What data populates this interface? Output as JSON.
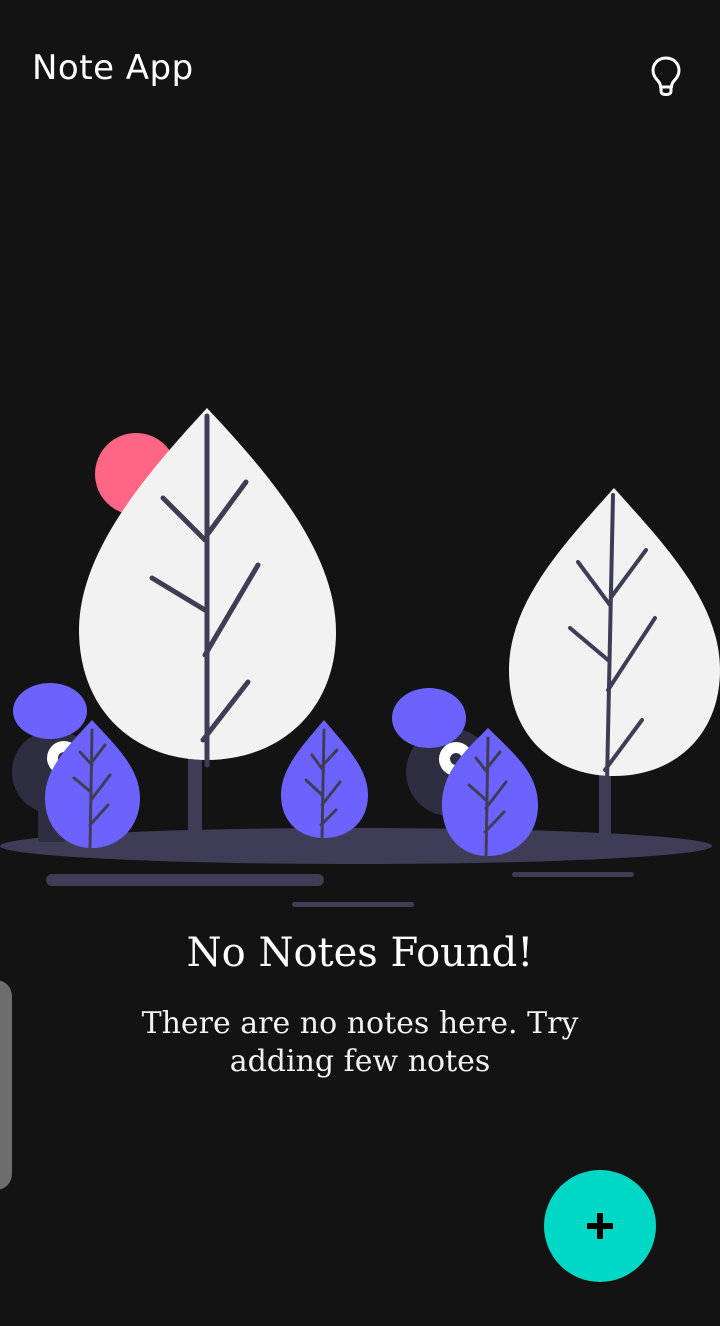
{
  "header": {
    "title": "Note App",
    "theme_toggle_icon": "lightbulb-icon"
  },
  "empty_state": {
    "title": "No Notes Found!",
    "message": "There are no notes here. Try adding few notes",
    "illustration": "trees-and-creatures-illustration"
  },
  "fab": {
    "icon": "plus-icon"
  },
  "colors": {
    "background": "#131313",
    "accent": "#00d7c4",
    "illustration_purple": "#6c63ff",
    "illustration_pink": "#ff6584",
    "illustration_dark": "#3f3d56",
    "illustration_light": "#f2f2f2"
  }
}
